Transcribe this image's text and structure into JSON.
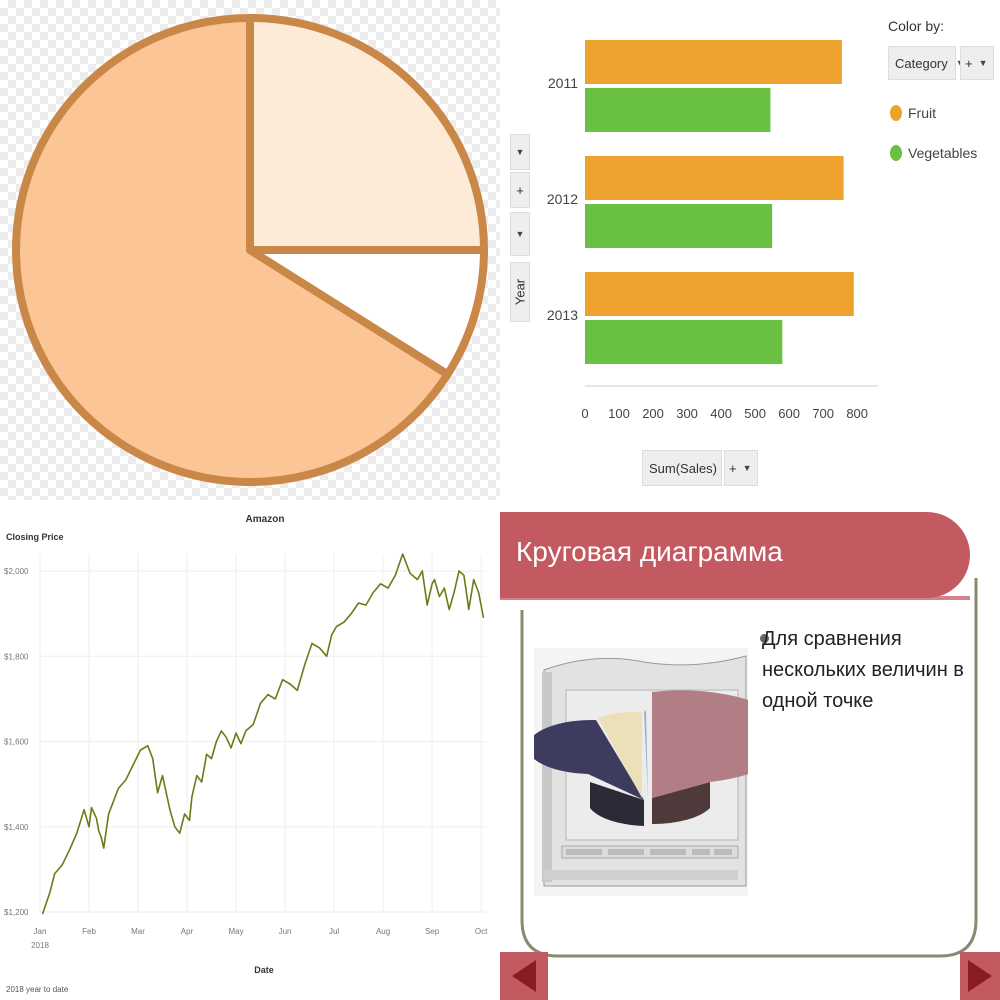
{
  "chart_data": [
    {
      "type": "pie",
      "slices": [
        {
          "label": "",
          "value": 66,
          "color": "#fbc596"
        },
        {
          "label": "",
          "value": 25,
          "color": "#fdebd8"
        },
        {
          "label": "",
          "value": 9,
          "color": "#ffffff"
        }
      ],
      "stroke_color": "#c98848"
    },
    {
      "type": "bar",
      "orientation": "horizontal",
      "categories": [
        "2011",
        "2012",
        "2013"
      ],
      "series": [
        {
          "name": "Fruit",
          "values": [
            755,
            760,
            790
          ],
          "color": "#eca22d"
        },
        {
          "name": "Vegetables",
          "values": [
            545,
            550,
            580
          ],
          "color": "#6ac043"
        }
      ],
      "xlim": [
        0,
        820
      ],
      "xticks": [
        "0",
        "100",
        "200",
        "300",
        "400",
        "500",
        "600",
        "700",
        "800"
      ],
      "xlabel": "Sum(Sales)",
      "ylabel": "Year",
      "legend_title": "Color by:",
      "color_by_value": "Category",
      "legend_placement": "top-right"
    },
    {
      "type": "line",
      "title": "Amazon",
      "ylabel": "Closing Price",
      "xlabel": "Date",
      "footnote": "2018 year to date",
      "x_labels": [
        "Jan\n2018",
        "Feb",
        "Mar",
        "Apr",
        "May",
        "Jun",
        "Jul",
        "Aug",
        "Sep",
        "Oct"
      ],
      "y_ticks": [
        "$1,200",
        "$1,400",
        "$1,600",
        "$1,800",
        "$2,000"
      ],
      "ylim": [
        1200,
        2040
      ],
      "x_range": [
        0,
        9.1
      ],
      "series": [
        {
          "name": "",
          "color": "#6b7b16",
          "x": [
            0.05,
            0.2,
            0.3,
            0.45,
            0.6,
            0.75,
            0.9,
            1.0,
            1.05,
            1.15,
            1.2,
            1.25,
            1.3,
            1.4,
            1.5,
            1.6,
            1.75,
            1.9,
            2.05,
            2.2,
            2.3,
            2.4,
            2.5,
            2.65,
            2.75,
            2.85,
            2.95,
            3.05,
            3.1,
            3.2,
            3.3,
            3.4,
            3.5,
            3.6,
            3.7,
            3.8,
            3.9,
            4.0,
            4.1,
            4.2,
            4.35,
            4.5,
            4.65,
            4.8,
            4.95,
            5.1,
            5.25,
            5.4,
            5.55,
            5.7,
            5.85,
            5.95,
            6.05,
            6.2,
            6.35,
            6.5,
            6.65,
            6.8,
            6.95,
            7.1,
            7.25,
            7.4,
            7.55,
            7.7,
            7.8,
            7.9,
            8.0,
            8.05,
            8.15,
            8.25,
            8.35,
            8.45,
            8.55,
            8.65,
            8.75,
            8.85,
            8.95,
            9.05
          ],
          "y": [
            1195,
            1245,
            1290,
            1310,
            1345,
            1385,
            1440,
            1400,
            1445,
            1420,
            1390,
            1375,
            1350,
            1430,
            1460,
            1490,
            1510,
            1545,
            1580,
            1590,
            1560,
            1480,
            1520,
            1440,
            1400,
            1385,
            1430,
            1415,
            1470,
            1520,
            1505,
            1570,
            1560,
            1600,
            1625,
            1610,
            1585,
            1620,
            1595,
            1625,
            1640,
            1690,
            1710,
            1700,
            1745,
            1735,
            1720,
            1780,
            1830,
            1820,
            1800,
            1850,
            1870,
            1880,
            1900,
            1925,
            1920,
            1950,
            1970,
            1960,
            1990,
            2040,
            1995,
            1980,
            2000,
            1920,
            1970,
            1980,
            1940,
            1960,
            1910,
            1950,
            2000,
            1990,
            1910,
            1980,
            1950,
            1890
          ]
        }
      ]
    },
    {
      "type": "other",
      "title": "Круговая диаграмма",
      "bullet": "Для сравнения нескольких величин в одной точке",
      "accent": "#c45a61",
      "frame_color": "#8c8a6e"
    }
  ]
}
